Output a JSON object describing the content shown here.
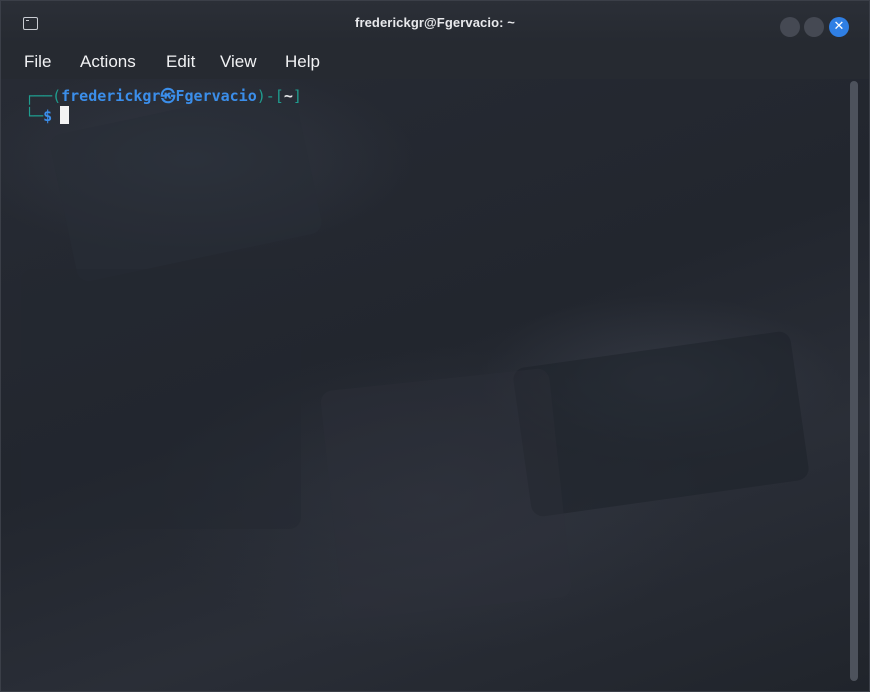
{
  "window": {
    "title": "frederickgr@Fgervacio: ~",
    "close_glyph": "✕"
  },
  "menu": {
    "items": [
      "File",
      "Actions",
      "Edit",
      "View",
      "Help"
    ]
  },
  "terminal": {
    "prompt_open": "┌──(",
    "user_host": "frederickgr㉿Fgervacio",
    "bracket_mid": ")-[",
    "cwd": "~",
    "bracket_close": "]",
    "prompt_corner": "└─",
    "prompt_symbol": "$"
  },
  "colors": {
    "accent": "#3b8eea",
    "bracket": "#1f9d8f",
    "background": "#21252d"
  },
  "icons": {
    "app": "terminal-icon",
    "close": "close-icon"
  }
}
